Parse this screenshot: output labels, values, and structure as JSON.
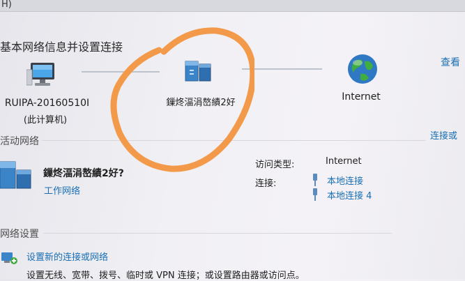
{
  "window": {
    "title_fragment": "H)"
  },
  "header": {
    "title": "基本网络信息并设置连接",
    "see_full_map": "查看"
  },
  "network_map": {
    "computer": {
      "name": "RUIPA-20160510I",
      "note": "(此计算机)",
      "icon": "computer-icon"
    },
    "network": {
      "name": "鏁炵湢涓嶅績2好",
      "icon": "network-icon"
    },
    "internet": {
      "name": "Internet",
      "icon": "globe-icon"
    }
  },
  "active_networks": {
    "title": "活动网络",
    "connect_link": "连接或",
    "network_name": "鏁炵湢涓嶅績2好?",
    "network_type": "工作网络",
    "access_type_label": "访问类型:",
    "access_type_value": "Internet",
    "connections_label": "连接:",
    "connections": [
      "本地连接",
      "本地连接 4"
    ]
  },
  "change_settings": {
    "title": "网络设置",
    "setup_link": "设置新的连接或网络",
    "setup_desc": "设置无线、宽带、拨号、临时或 VPN 连接；或设置路由器或访问点。"
  },
  "colors": {
    "link": "#1a6fb4",
    "annotation": "#f39a4a"
  }
}
